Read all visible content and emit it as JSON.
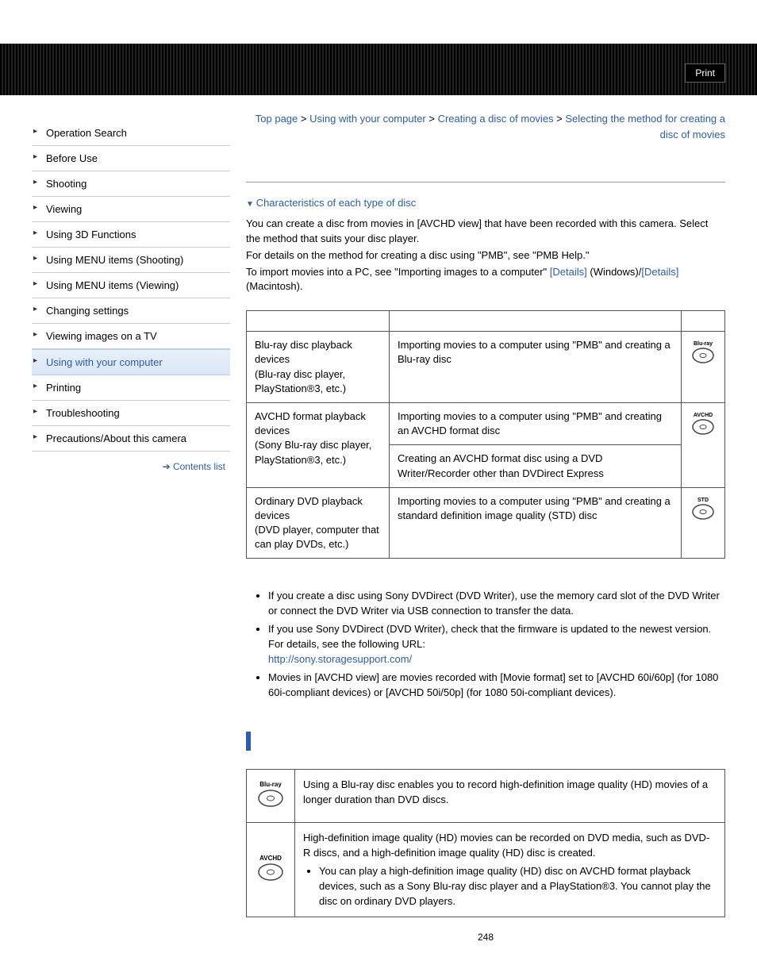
{
  "header": {
    "print_label": "Print"
  },
  "sidebar": {
    "items": [
      {
        "label": "Operation Search"
      },
      {
        "label": "Before Use"
      },
      {
        "label": "Shooting"
      },
      {
        "label": "Viewing"
      },
      {
        "label": "Using 3D Functions"
      },
      {
        "label": "Using MENU items (Shooting)"
      },
      {
        "label": "Using MENU items (Viewing)"
      },
      {
        "label": "Changing settings"
      },
      {
        "label": "Viewing images on a TV"
      },
      {
        "label": "Using with your computer",
        "active": true
      },
      {
        "label": "Printing"
      },
      {
        "label": "Troubleshooting"
      },
      {
        "label": "Precautions/About this camera"
      }
    ],
    "contents_list": "Contents list"
  },
  "breadcrumb": {
    "top": "Top page",
    "sep": " > ",
    "a": "Using with your computer",
    "b": "Creating a disc of movies",
    "c": "Selecting the method for creating a disc of movies"
  },
  "intro": {
    "anchor": "Characteristics of each type of disc",
    "p1": "You can create a disc from movies in [AVCHD view] that have been recorded with this camera. Select the method that suits your disc player.",
    "p2": "For details on the method for creating a disc using \"PMB\", see \"PMB Help.\"",
    "p3a": "To import movies into a PC, see \"Importing images to a computer\" ",
    "details1": "[Details]",
    "p3b": " (Windows)/",
    "details2": "[Details]",
    "p3c": " (Macintosh)."
  },
  "table1": {
    "r1c1_a": "Blu-ray disc playback devices",
    "r1c1_b": "(Blu-ray disc player, PlayStation®3, etc.)",
    "r1c2": "Importing movies to a computer using \"PMB\" and creating a Blu-ray disc",
    "r2c1_a": "AVCHD format playback devices",
    "r2c1_b": "(Sony Blu-ray disc player, PlayStation®3, etc.)",
    "r2c2a": "Importing movies to a computer using \"PMB\" and creating an AVCHD format disc",
    "r2c2b": "Creating an AVCHD format disc using a DVD Writer/Recorder other than DVDirect Express",
    "r3c1_a": "Ordinary DVD playback devices",
    "r3c1_b": "(DVD player, computer that can play DVDs, etc.)",
    "r3c2": "Importing movies to a computer using \"PMB\" and creating a standard definition image quality (STD) disc",
    "icon1": "Blu-ray",
    "icon2": "AVCHD",
    "icon3": "STD"
  },
  "notes": {
    "n1": "If you create a disc using Sony DVDirect (DVD Writer), use the memory card slot of the DVD Writer or connect the DVD Writer via USB connection to transfer the data.",
    "n2": "If you use Sony DVDirect (DVD Writer), check that the firmware is updated to the newest version.",
    "n2b": "For details, see the following URL:",
    "n2_url": "http://sony.storagesupport.com/",
    "n3": "Movies in [AVCHD view] are movies recorded with [Movie format] set to [AVCHD 60i/60p] (for 1080 60i-compliant devices) or [AVCHD 50i/50p] (for 1080 50i-compliant devices)."
  },
  "char_table": {
    "r1_icon": "Blu-ray",
    "r1": "Using a Blu-ray disc enables you to record high-definition image quality (HD) movies of a longer duration than DVD discs.",
    "r2_icon": "AVCHD",
    "r2a": "High-definition image quality (HD) movies can be recorded on DVD media, such as DVD-R discs, and a high-definition image quality (HD) disc is created.",
    "r2b": "You can play a high-definition image quality (HD) disc on AVCHD format playback devices, such as a Sony Blu-ray disc player and a PlayStation®3. You cannot play the disc on ordinary DVD players."
  },
  "page_number": "248"
}
